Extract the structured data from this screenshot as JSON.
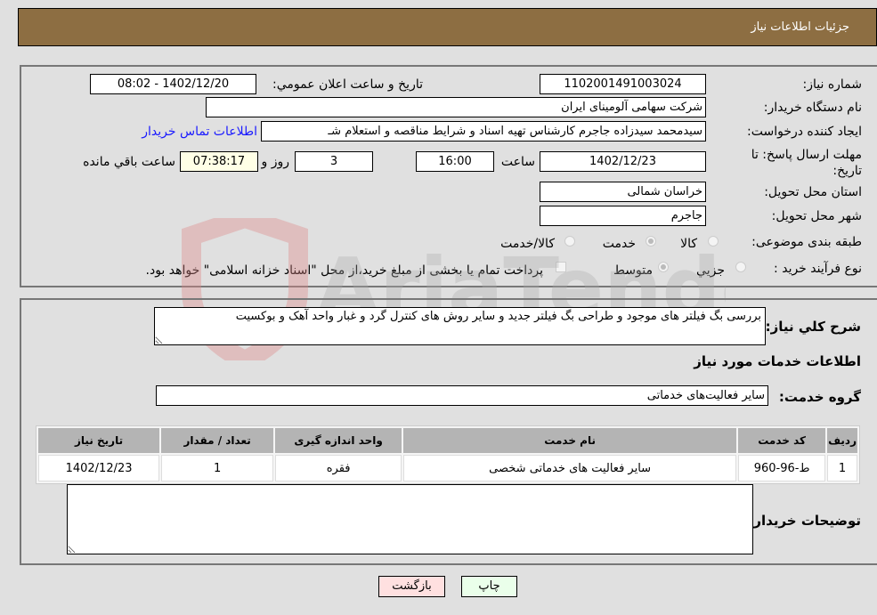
{
  "header": {
    "title": "جزئیات اطلاعات نیاز"
  },
  "fields": {
    "need_number": {
      "label": "شماره نیاز:",
      "value": "1102001491003024"
    },
    "announce_datetime": {
      "label": "تاريخ و ساعت اعلان عمومي:",
      "value": "1402/12/20 - 08:02"
    },
    "buyer_org": {
      "label": "نام دستگاه خریدار:",
      "value": "شرکت سهامی آلومینای ایران"
    },
    "requester": {
      "label": "ایجاد کننده درخواست:",
      "value": "سیدمحمد سیدزاده جاجرم کارشناس تهیه اسناد و شرایط  مناقصه و استعلام شـ",
      "contact_link": "اطلاعات تماس خریدار"
    },
    "deadline": {
      "label": "مهلت ارسال پاسخ: تا تاریخ:",
      "date": "1402/12/23",
      "time_label": "ساعت",
      "time": "16:00",
      "days": "3",
      "days_label": "روز و",
      "remaining": "07:38:17",
      "remaining_label": "ساعت باقي مانده"
    },
    "province": {
      "label": "استان محل تحویل:",
      "value": "خراسان شمالی"
    },
    "city": {
      "label": "شهر محل تحویل:",
      "value": "جاجرم"
    },
    "category": {
      "label": "طبقه بندی موضوعی:",
      "options": [
        "کالا",
        "خدمت",
        "کالا/خدمت"
      ],
      "selected": "خدمت"
    },
    "purchase_type": {
      "label": "نوع فرآیند خرید :",
      "options": [
        "جزيي",
        "متوسط"
      ],
      "selected": "متوسط",
      "treasury_note": "پرداخت تمام یا بخشی از مبلغ خرید،از محل \"اسناد خزانه اسلامی\" خواهد بود."
    }
  },
  "description": {
    "label": "شرح کلي نياز:",
    "value": "بررسی بگ فیلتر های موجود و طراحی بگ فیلتر جدید و سایر روش های کنترل گرد و غبار واحد آهک و بوکسیت"
  },
  "services_section": {
    "title": "اطلاعات خدمات مورد نياز",
    "group_label": "گروه خدمت:",
    "group_value": "سایر فعالیت‌های خدماتی"
  },
  "table": {
    "columns": [
      "رديف",
      "کد خدمت",
      "نام خدمت",
      "واحد اندازه گيری",
      "تعداد / مقدار",
      "تاريخ نياز"
    ],
    "rows": [
      [
        "1",
        "ط-96-960",
        "سایر فعالیت های خدماتی شخصی",
        "فقره",
        "1",
        "1402/12/23"
      ]
    ]
  },
  "buyer_notes": {
    "label": "توضيحات خريدار:",
    "value": ""
  },
  "buttons": {
    "print": "چاپ",
    "back": "بازگشت"
  },
  "watermark": {
    "text": "AriaTender.neT"
  },
  "colors": {
    "header_bg": "#8d6e42",
    "print_bg": "#eaffea",
    "back_bg": "#ffe0e0",
    "link": "#1a1aff"
  }
}
